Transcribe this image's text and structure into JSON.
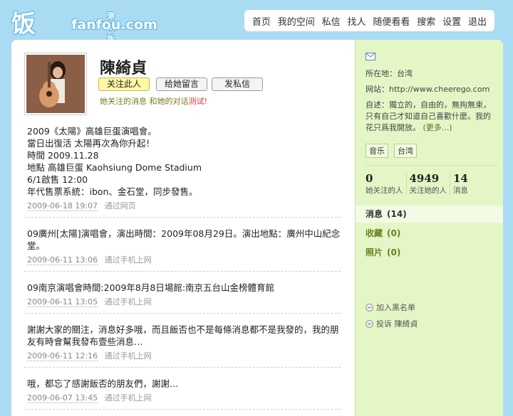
{
  "header": {
    "logo_cn": "饭否",
    "logo_en": "fanfou.com",
    "logo_beta": "测试版",
    "nav": [
      "首页",
      "我的空间",
      "私信",
      "找人",
      "随便看看",
      "搜索",
      "设置",
      "退出"
    ]
  },
  "profile": {
    "name": "陳綺貞",
    "buttons": {
      "follow": "关注此人",
      "message": "给她留言",
      "dm": "发私信"
    },
    "links": {
      "her_following_msgs": "她关注的消息",
      "conversation_pre": "和她的对话",
      "test": "测试!"
    }
  },
  "statuses": [
    {
      "text": "2009《太陽》高雄巨蛋演唱會。\n當日出復活 太陽再次為你升起！\n時間 2009.11.28\n地點 高雄巨蛋 Kaohsiung Dome Stadium\n6/1啟售 12:00\n年代售票系統：ibon、金石堂，同步發售。",
      "time": "2009-06-18 19:07",
      "via": "通过网页"
    },
    {
      "text": "09廣州[太陽]演唱會，演出時間：2009年08月29日。演出地點：廣州中山紀念堂。",
      "time": "2009-06-11 13:06",
      "via": "通过手机上网"
    },
    {
      "text": "09南京演唱會時間:2009年8月8日場館:南京五台山金榜體育館",
      "time": "2009-06-11 13:05",
      "via": "通过手机上网"
    },
    {
      "text": "謝謝大家的關注，消息好多哦，而且飯否也不是每條消息都不是我發的，我的朋友有時會幫我發布壹些消息…",
      "time": "2009-06-11 12:16",
      "via": "通过手机上网"
    },
    {
      "text": "哦，都忘了感謝飯否的朋友們，謝謝…",
      "time": "2009-06-07 13:45",
      "via": "通过手机上网"
    }
  ],
  "sidebar": {
    "location_label": "所在地：",
    "location": "台湾",
    "website_label": "网站：",
    "website": "http://www.cheerego.com",
    "bio_label": "自述：",
    "bio": "獨立的，自由的，無拘無束，只有自己才知道自己喜歡什麼。我的花只爲我開放。",
    "more": "(更多...)",
    "tags": [
      "音乐",
      "台湾"
    ],
    "stats": [
      {
        "num": "0",
        "label": "她关注的人"
      },
      {
        "num": "4949",
        "label": "关注她的人"
      },
      {
        "num": "14",
        "label": "消息"
      }
    ],
    "menu": [
      {
        "label": "消息",
        "count": "(14)"
      },
      {
        "label": "收藏",
        "count": "(0)"
      },
      {
        "label": "照片",
        "count": "(0)"
      }
    ],
    "actions": {
      "block": "加入黑名单",
      "report": "投诉 陳綺貞"
    }
  }
}
